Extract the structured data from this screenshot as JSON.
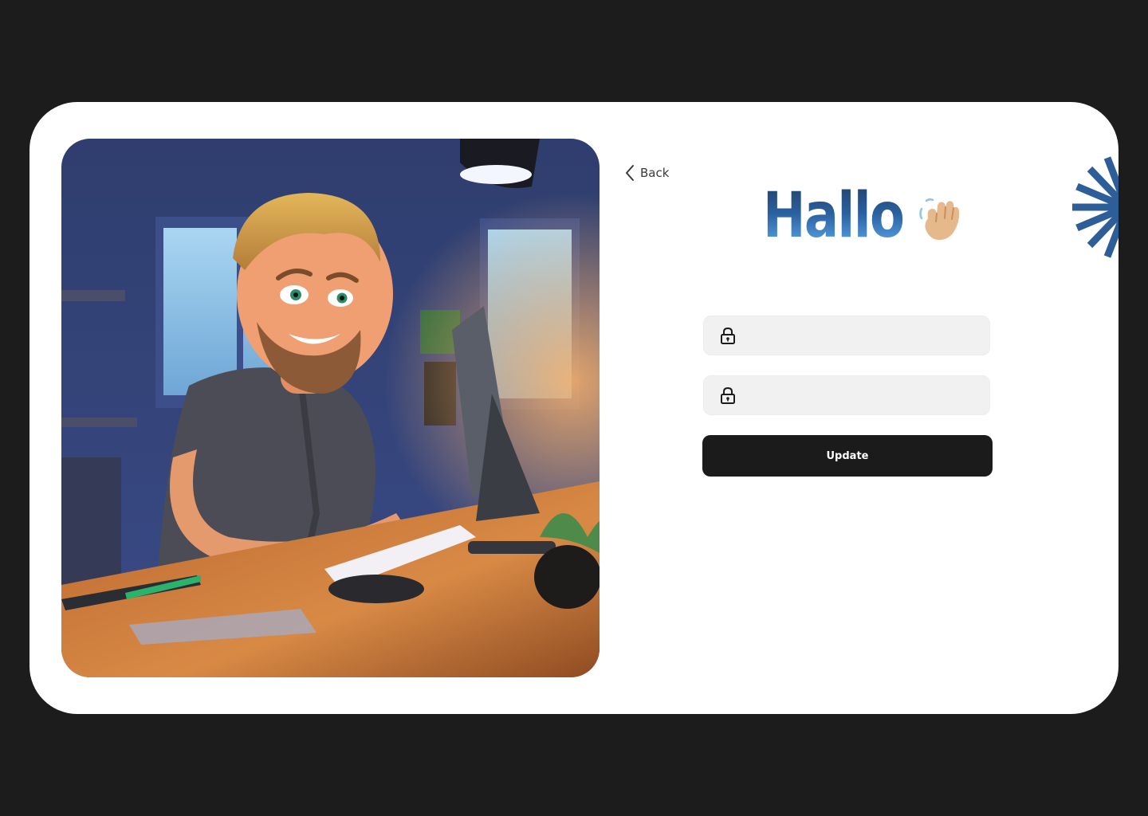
{
  "nav": {
    "back_label": "Back"
  },
  "header": {
    "greeting": "Hallo"
  },
  "form": {
    "password_field_1": {
      "value": "",
      "placeholder": ""
    },
    "password_field_2": {
      "value": "",
      "placeholder": ""
    },
    "submit_label": "Update"
  },
  "icons": {
    "back": "chevron-left-icon",
    "wave": "waving-hand-icon",
    "lock": "lock-icon",
    "decor": "sunburst-icon",
    "illustration": "developer-at-desk-illustration"
  },
  "colors": {
    "page_background": "#1c1c1c",
    "card_background": "#ffffff",
    "accent_blue": "#2a5f9e",
    "button_background": "#1b1b1b",
    "input_background": "#f1f1f1"
  }
}
